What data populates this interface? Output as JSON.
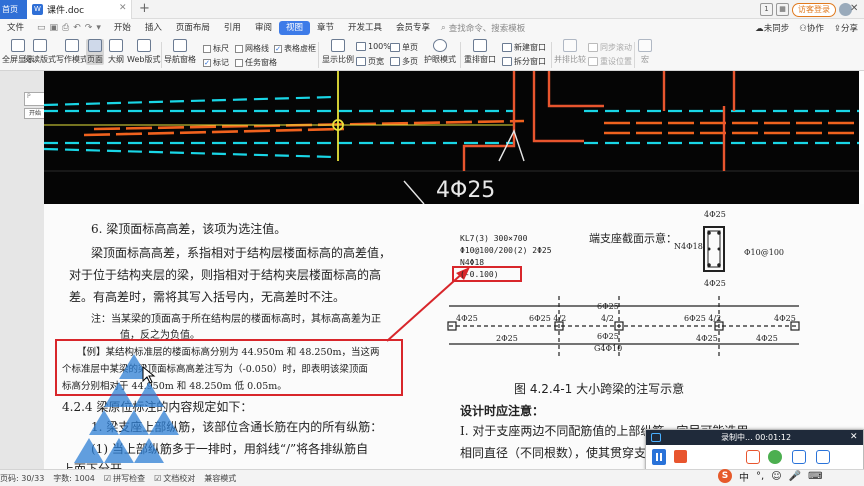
{
  "titlebar": {
    "home_tab": "首页",
    "doc_tab": "课件.doc",
    "doc_icon": "W",
    "new_tab": "+",
    "tab_count": "1",
    "login": "访客登录",
    "close": "✕"
  },
  "menubar": {
    "file": "文件",
    "items": [
      "开始",
      "插入",
      "页面布局",
      "引用",
      "审阅",
      "视图",
      "章节",
      "开发工具",
      "会员专享"
    ],
    "active": "视图",
    "search": "查找命令、搜索模板",
    "right": [
      "未同步",
      "协作",
      "分享"
    ]
  },
  "toolbar": {
    "big": [
      {
        "label": "全屏显示",
        "name": "fullscreen-button"
      },
      {
        "label": "阅读版式",
        "name": "reading-layout-button"
      },
      {
        "label": "写作模式",
        "name": "writing-mode-button"
      },
      {
        "label": "页面",
        "name": "page-view-button"
      },
      {
        "label": "大纲",
        "name": "outline-view-button"
      },
      {
        "label": "Web版式",
        "name": "web-layout-button"
      },
      {
        "label": "导航窗格",
        "name": "nav-pane-button"
      },
      {
        "label": "显示比例",
        "name": "zoom-button"
      },
      {
        "label": "护眼模式",
        "name": "eye-care-button"
      },
      {
        "label": "重排窗口",
        "name": "rearrange-window-button"
      },
      {
        "label": "并排比较",
        "name": "side-by-side-button"
      },
      {
        "label": "宏",
        "name": "macro-button"
      }
    ],
    "checks": [
      {
        "label": "标尺",
        "checked": false
      },
      {
        "label": "网格线",
        "checked": false
      },
      {
        "label": "表格虚框",
        "checked": true
      },
      {
        "label": "标记",
        "checked": true
      },
      {
        "label": "任务窗格",
        "checked": false
      }
    ],
    "zoom_100": "100%",
    "page_width": "页宽",
    "single_page": "单页",
    "multi_page": "多页",
    "new_window": "新建窗口",
    "split_window": "拆分窗口",
    "sync_scroll": "同步滚动",
    "reset_position": "重设位置"
  },
  "nav_tip": {
    "placeholder": "P",
    "label": "开始"
  },
  "cad": {
    "rebar_label": "4Φ25"
  },
  "document": {
    "heading6": "6. 梁顶面标高高差，该项为选注值。",
    "para1_l1": "梁顶面标高高差，系指相对于结构层楼面标高的高差值，",
    "para1_l2": "对于位于结构夹层的梁，则指相对于结构夹层楼面标高的高",
    "para1_l3": "差。有高差时，需将其写入括号内，无高差时不注。",
    "note_l1": "注：当某梁的顶面高于所在结构层的楼面标高时，其标高高差为正",
    "note_l2": "值，反之为负值。",
    "example_l1": "【例】某结构标准层的楼面标高分别为 44.950m 和 48.250m，当这两",
    "example_l2": "个标准层中某梁的梁顶面标高高差注写为（-0.050）时，即表明该梁顶面",
    "example_l3": "标高分别相对于 44.950m 和 48.250m 低 0.05m。",
    "sec424": "4.2.4  梁原位标注的内容规定如下：",
    "item1": "1. 梁支座上部纵筋，该部位含通长筋在内的所有纵筋：",
    "item1a": "(1) 当上部纵筋多于一排时，用斜线“/”将各排纵筋自",
    "item1b": "上而下分开。",
    "fig_kl": "KL7(3)  300×700",
    "fig_phi": "Φ10@100/200(2)  2Φ25",
    "fig_n4": "N4Φ18",
    "fig_elev": "(-0.100)",
    "fig_support_title": "端支座截面示意：",
    "fig_top": "4Φ25",
    "fig_n4b": "N4Φ18",
    "fig_stirrup": "Φ10@100",
    "fig_bottom": "4Φ25",
    "fig_span": [
      "4Φ25",
      "6Φ25 4/2",
      "6Φ25",
      "4/2",
      "6Φ25 4/2",
      "4Φ25",
      "2Φ25",
      "6Φ25",
      "G4Φ10",
      "4Φ25",
      "4Φ25"
    ],
    "fig_caption": "图 4.2.4-1  大小跨梁的注写示意",
    "design_title": "设计时应注意：",
    "design_1": "Ⅰ. 对于支座两边不同配筋值的上部纵筋，宜尽可能选用",
    "design_2": "相同直径（不同根数），使其贯穿支座"
  },
  "status": {
    "page": "页码: 30/33",
    "words": "字数: 1004",
    "spell": "拼写检查",
    "proof": "文档校对",
    "compat": "兼容模式"
  },
  "recorder": {
    "status": "录制中... 00:01:12",
    "close": "✕"
  },
  "ime": {
    "logo": "S",
    "lang": "中",
    "punct": "°,"
  }
}
